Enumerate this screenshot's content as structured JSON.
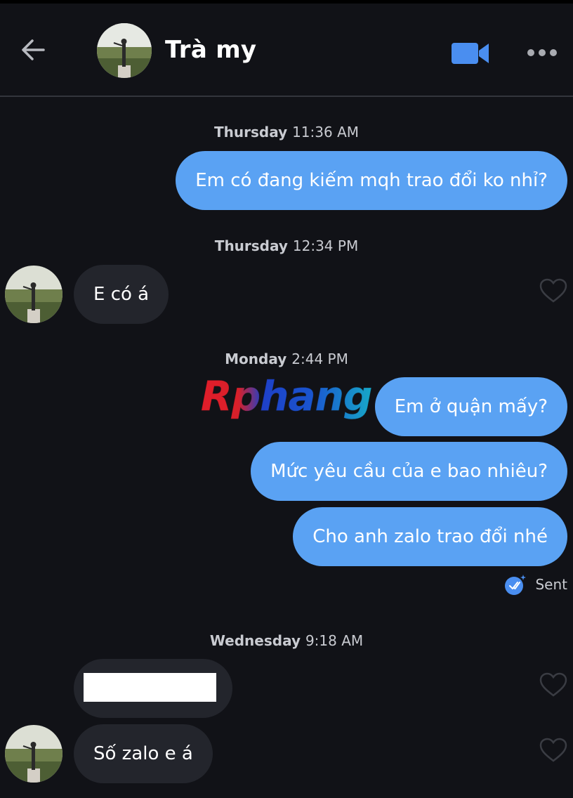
{
  "header": {
    "contact_name": "Trà my",
    "back_icon": "arrow-left-icon",
    "video_icon": "video-camera-icon",
    "more_icon": "more-horizontal-icon",
    "video_color": "#4a8ef0"
  },
  "conversation": {
    "groups": [
      {
        "day": "Thursday",
        "time": "11:36 AM",
        "messages": [
          {
            "direction": "outgoing",
            "text": "Em có đang kiếm mqh trao đổi ko nhỉ?"
          }
        ]
      },
      {
        "day": "Thursday",
        "time": "12:34 PM",
        "messages": [
          {
            "direction": "incoming",
            "text": "E có á"
          }
        ]
      },
      {
        "day": "Monday",
        "time": "2:44 PM",
        "messages": [
          {
            "direction": "outgoing",
            "text": "Em ở quận mấy?"
          },
          {
            "direction": "outgoing",
            "text": "Mức yêu cầu của e bao nhiêu?"
          },
          {
            "direction": "outgoing",
            "text": "Cho anh zalo trao đổi nhé"
          }
        ],
        "status": "Sent"
      },
      {
        "day": "Wednesday",
        "time": "9:18 AM",
        "messages": [
          {
            "direction": "incoming",
            "text": "",
            "redacted": true
          },
          {
            "direction": "incoming",
            "text": "Số zalo e á"
          }
        ]
      }
    ]
  },
  "watermark": "Rphang",
  "colors": {
    "outgoing_bubble": "#5aa2f3",
    "incoming_bubble": "#23252c",
    "background": "#111217"
  }
}
